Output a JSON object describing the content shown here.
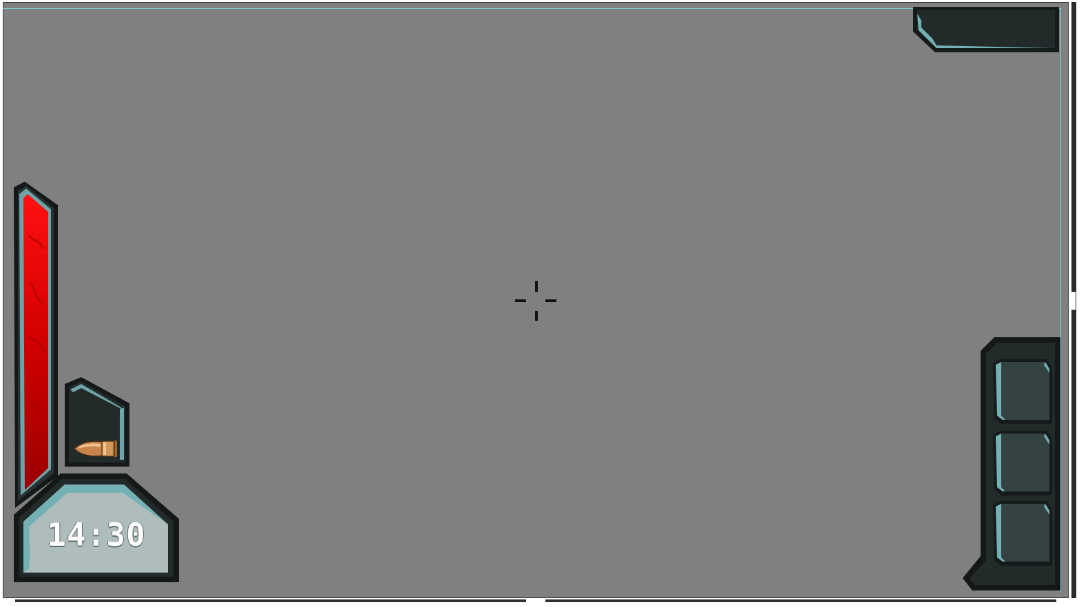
{
  "hud": {
    "timer": "14:30",
    "health": 1.0,
    "ammo_icon": "bullet-icon",
    "crosshair_icon": "crosshair-icon",
    "inventory_slots": 3
  },
  "colors": {
    "background": "#808080",
    "panel_dark": "#222828",
    "panel_edge": "#6fa3a7",
    "health_fill": "#d40000",
    "timer_panel": "#aebcbc"
  }
}
